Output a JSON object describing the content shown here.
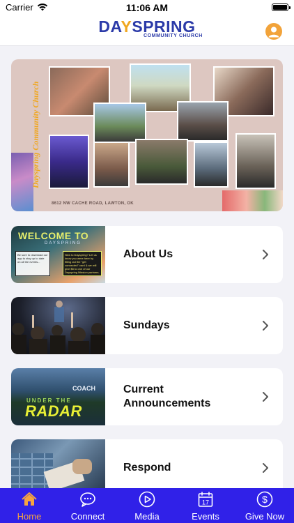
{
  "status_bar": {
    "carrier": "Carrier",
    "time": "11:06 AM",
    "battery_level": 1.0
  },
  "header": {
    "logo_main_before": "DA",
    "logo_main_y": "Y",
    "logo_main_after": "SPRING",
    "logo_sub": "COMMUNITY CHURCH",
    "profile_icon": "person-circle-icon"
  },
  "banner": {
    "vertical_title": "Dayspring Community Church",
    "address": "8612 NW CACHE ROAD, LAWTON, OK"
  },
  "menu": {
    "items": [
      {
        "label": "About Us",
        "thumb_title": "WELCOME TO",
        "thumb_subtitle": "DAYSPRING",
        "thumb_box1": "Be sure to download our app to stay up to date on all the events...",
        "thumb_box2": "New to Dayspring? Let us know you were here by filling out the \"get connected\" card & we will give $5 to one of our Dayspring Mission partners."
      },
      {
        "label": "Sundays"
      },
      {
        "label": "Current Announcements",
        "thumb_coach": "COACH",
        "thumb_under": "UNDER THE",
        "thumb_radar": "RADAR"
      },
      {
        "label": "Respond"
      }
    ],
    "chevron_icon": "chevron-right-icon"
  },
  "tabbar": {
    "tabs": [
      {
        "label": "Home",
        "icon": "home-icon",
        "active": true
      },
      {
        "label": "Connect",
        "icon": "chat-bubble-icon",
        "active": false
      },
      {
        "label": "Media",
        "icon": "play-circle-icon",
        "active": false
      },
      {
        "label": "Events",
        "icon": "calendar-icon",
        "active": false,
        "calendar_day": "17"
      },
      {
        "label": "Give Now",
        "icon": "dollar-circle-icon",
        "active": false
      }
    ]
  },
  "colors": {
    "brand_blue": "#2b3aa8",
    "brand_orange": "#f0a720",
    "tabbar_bg": "#3021e8",
    "active_tab": "#f5a340"
  }
}
